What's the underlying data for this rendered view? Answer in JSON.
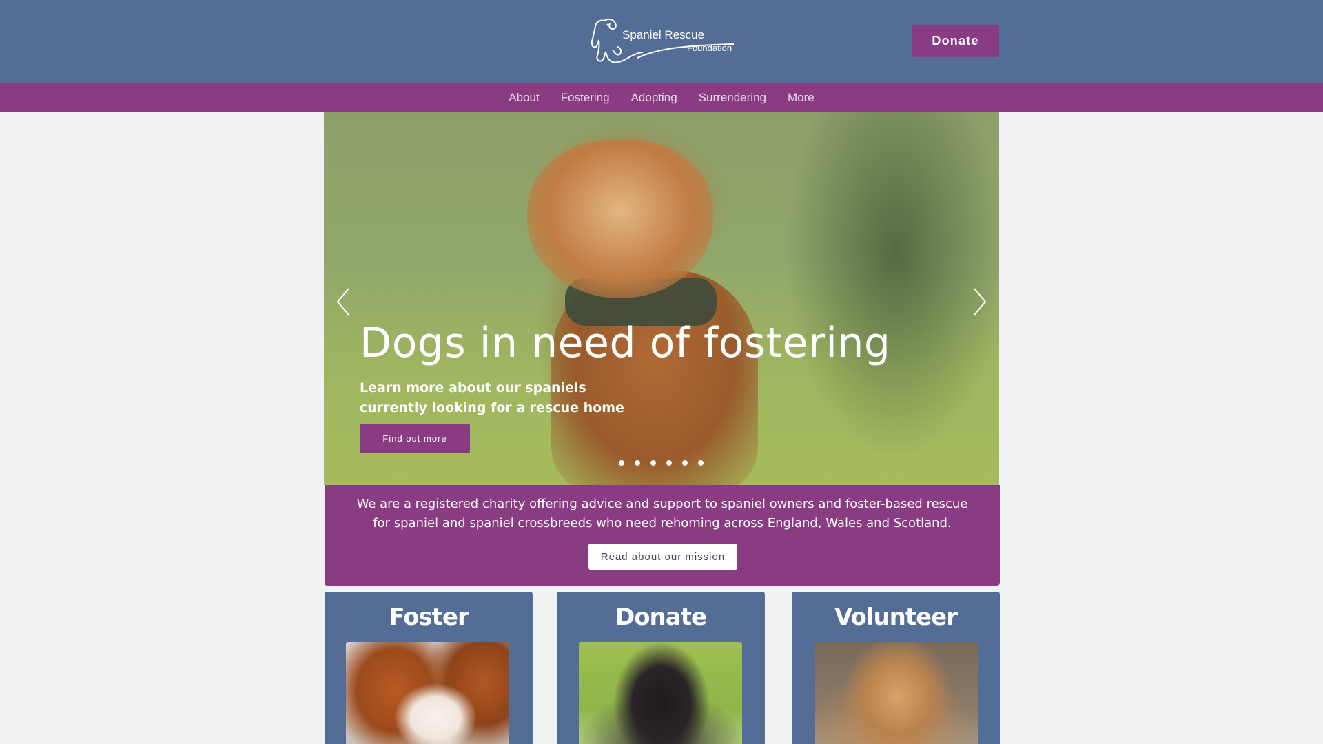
{
  "header": {
    "logo_line1": "Spaniel Rescue",
    "logo_line2": "Foundation",
    "donate_label": "Donate",
    "background": "#546d96",
    "accent": "#8a3c82"
  },
  "nav": {
    "items": [
      {
        "label": "About"
      },
      {
        "label": "Fostering"
      },
      {
        "label": "Adopting"
      },
      {
        "label": "Surrendering"
      },
      {
        "label": "More"
      }
    ]
  },
  "hero": {
    "title": "Dogs in need of fostering",
    "subtitle": "Learn more about our spaniels currently looking for a rescue home",
    "button_label": "Find out more",
    "prev_icon": "chevron-left-icon",
    "next_icon": "chevron-right-icon",
    "slide_count": 6
  },
  "mission": {
    "text": "We are a registered charity offering advice and support to spaniel owners and foster-based rescue for spaniel and spaniel crossbreeds who need rehoming across England, Wales and Scotland.",
    "button_label": "Read about our mission"
  },
  "cards": [
    {
      "title": "Foster"
    },
    {
      "title": "Donate"
    },
    {
      "title": "Volunteer"
    }
  ]
}
